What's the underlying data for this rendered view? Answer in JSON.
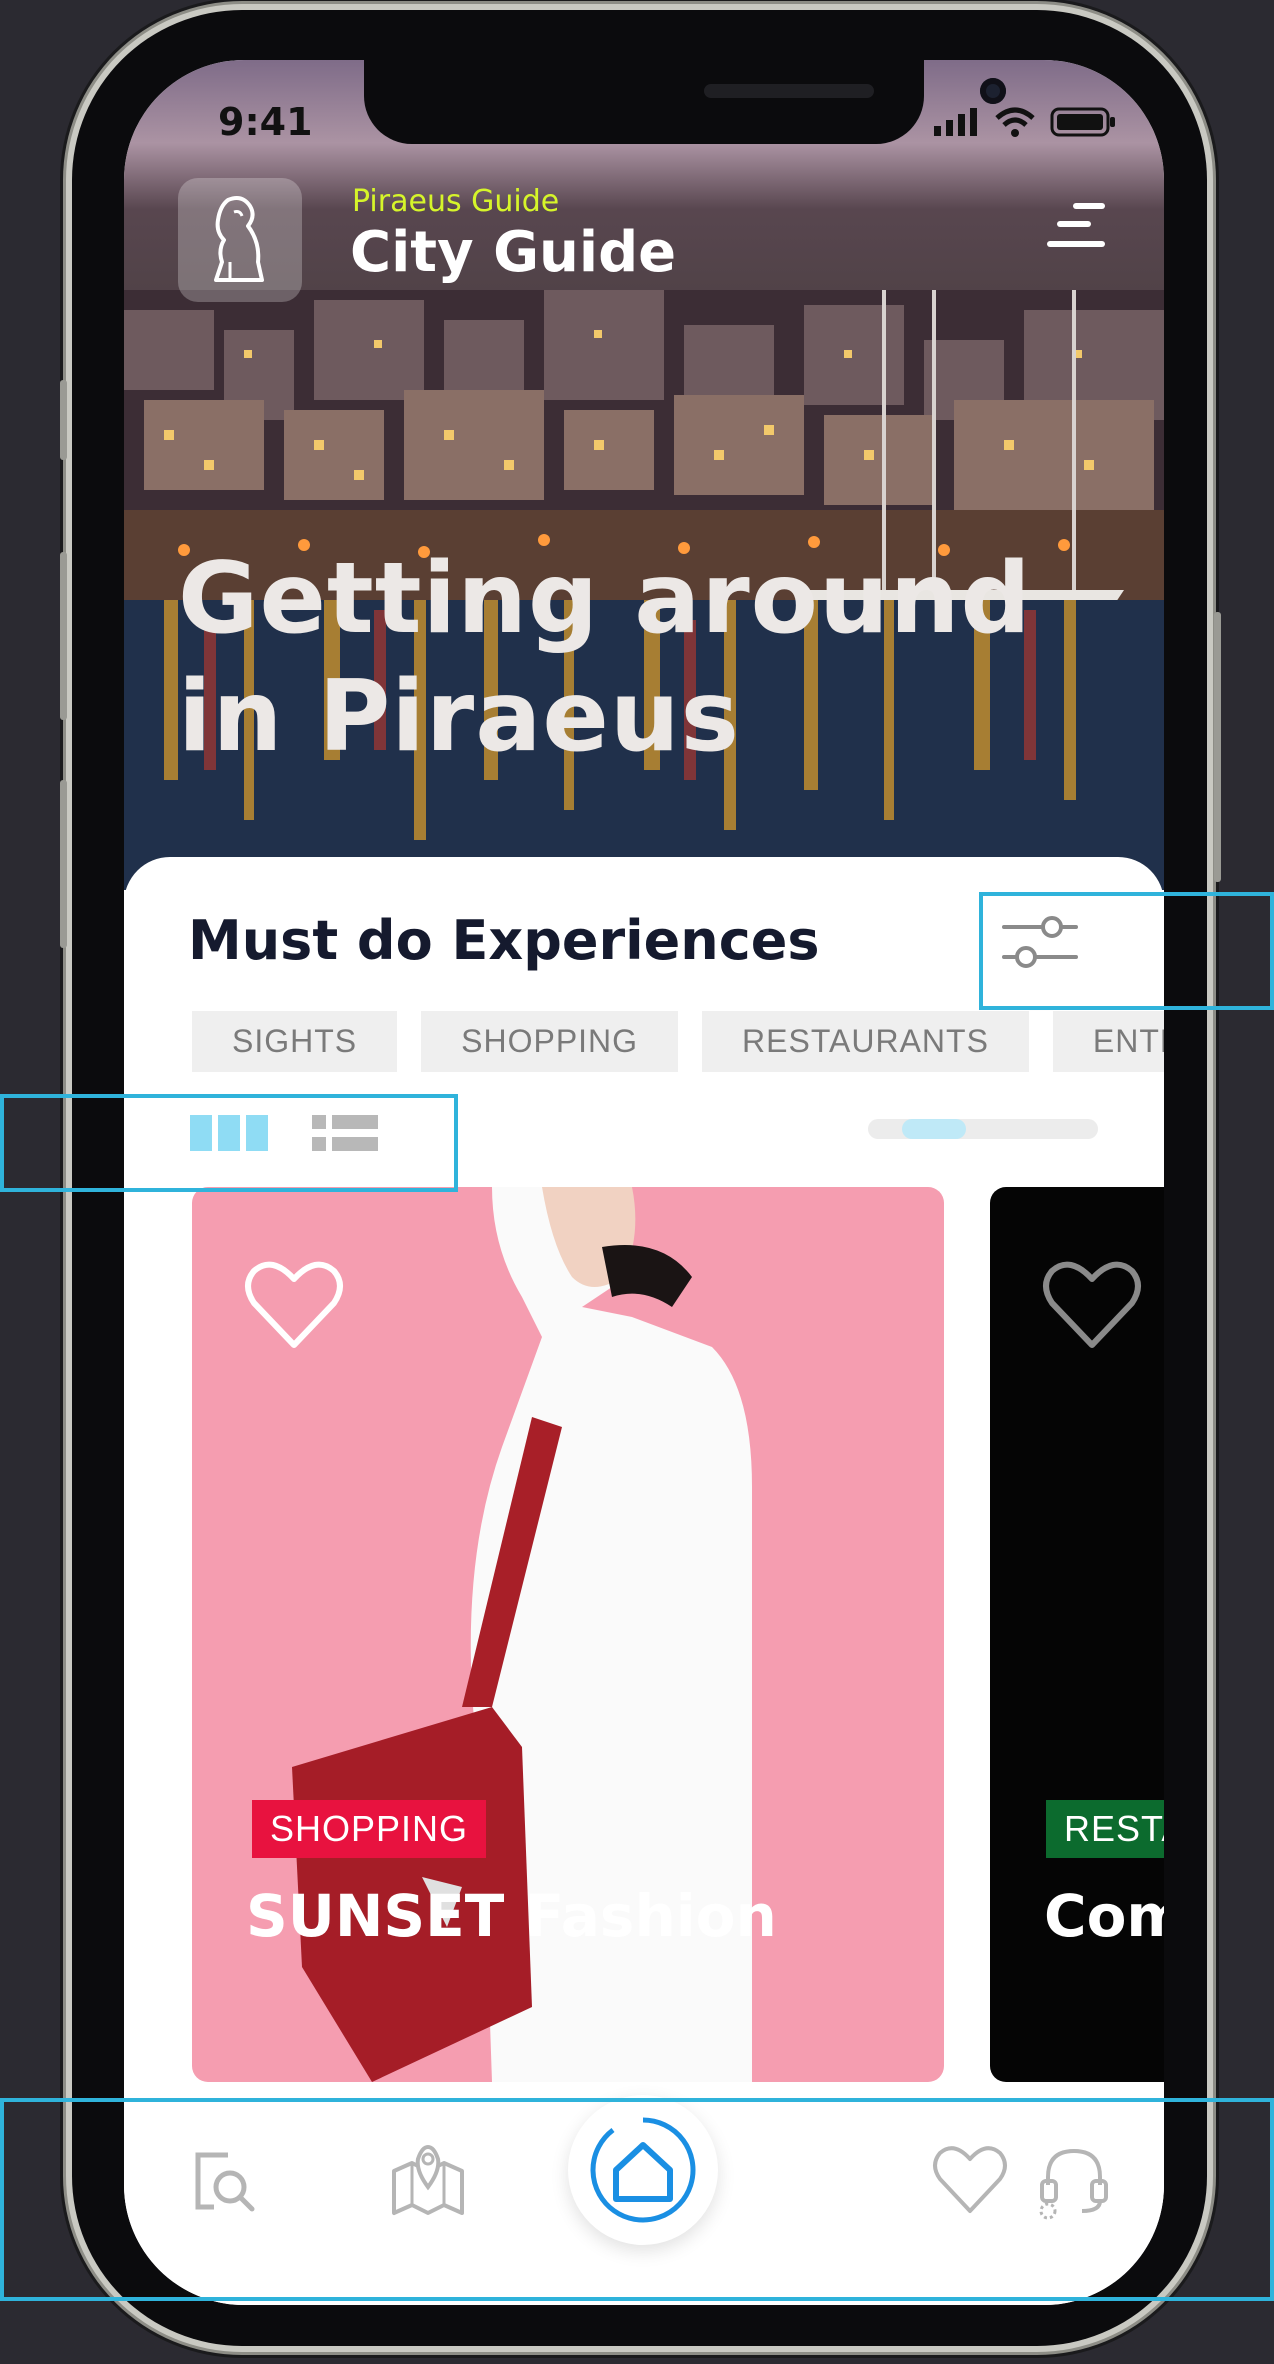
{
  "status_bar": {
    "time": "9:41"
  },
  "header": {
    "subtitle": "Piraeus Guide",
    "title": "City Guide"
  },
  "hero": {
    "title_line1": "Getting around",
    "title_line2": "in Piraeus"
  },
  "section": {
    "title": "Must do Experiences",
    "chips": [
      "SIGHTS",
      "SHOPPING",
      "RESTAURANTS",
      "ENTERTA"
    ]
  },
  "cards": [
    {
      "tag": "SHOPPING",
      "tag_color": "#e8123f",
      "title": "SUNSET Fashion"
    },
    {
      "tag": "RESTA",
      "tag_color": "#0c6b2e",
      "title": "Com"
    }
  ],
  "scroll_indicator": {
    "position": 0.2
  },
  "nav": {
    "items": [
      "search-icon",
      "map-icon",
      "home-icon",
      "heart-icon",
      "support-icon"
    ],
    "active": "home-icon",
    "accent": "#1a8fe3"
  },
  "highlight_color": "#2fb3db"
}
